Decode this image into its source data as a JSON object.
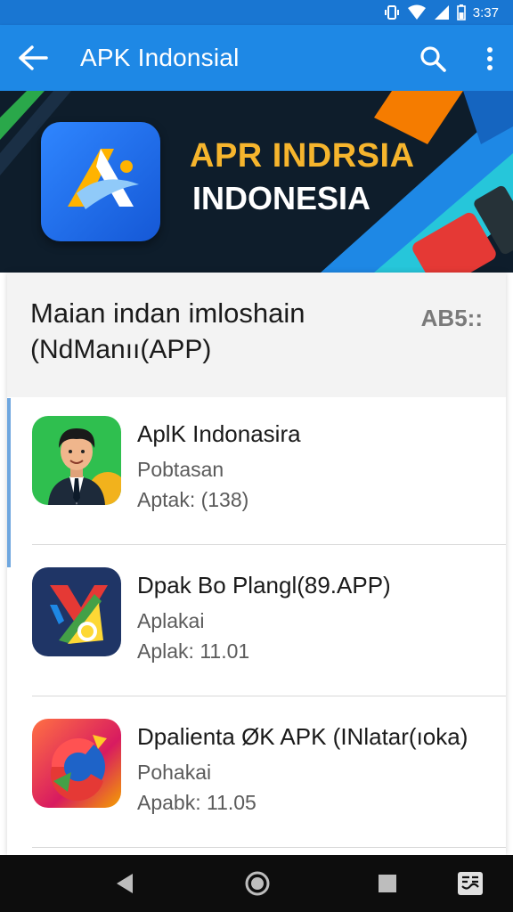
{
  "status_bar": {
    "time": "3:37",
    "icons": [
      "vibrate-icon",
      "wifi-icon",
      "signal-icon",
      "battery-icon"
    ]
  },
  "app_bar": {
    "title": "APK Indonsial",
    "icons": [
      "back-arrow-icon",
      "search-icon",
      "more-vert-icon"
    ]
  },
  "banner": {
    "title_line1": "APR INDRSIA",
    "title_line2": "INDONESIA"
  },
  "list_header": {
    "title_line1": "Maian indan imloshain",
    "title_line2": "(NdManıı(APP)",
    "badge": "AB5::"
  },
  "apps": [
    {
      "name": "AplK Indonasira",
      "subtitle": "Pobtasan",
      "meta": "Aptak: (138)"
    },
    {
      "name": "Dpak Bo Plangl(89.APP)",
      "subtitle": "Aplakai",
      "meta": "Aplak: 11.01"
    },
    {
      "name": "Dpalienta ØK APK (INlatar(ıoka)",
      "subtitle": "Pohakai",
      "meta": "Apabk: 11.05"
    }
  ],
  "nav_bar": {
    "icons": [
      "back-triangle-icon",
      "home-circle-icon",
      "recents-square-icon",
      "keyboard-switch-icon"
    ]
  },
  "colors": {
    "app_bar": "#1e88e5",
    "status_bar": "#1976d2",
    "banner_title": "#f6b52d"
  }
}
